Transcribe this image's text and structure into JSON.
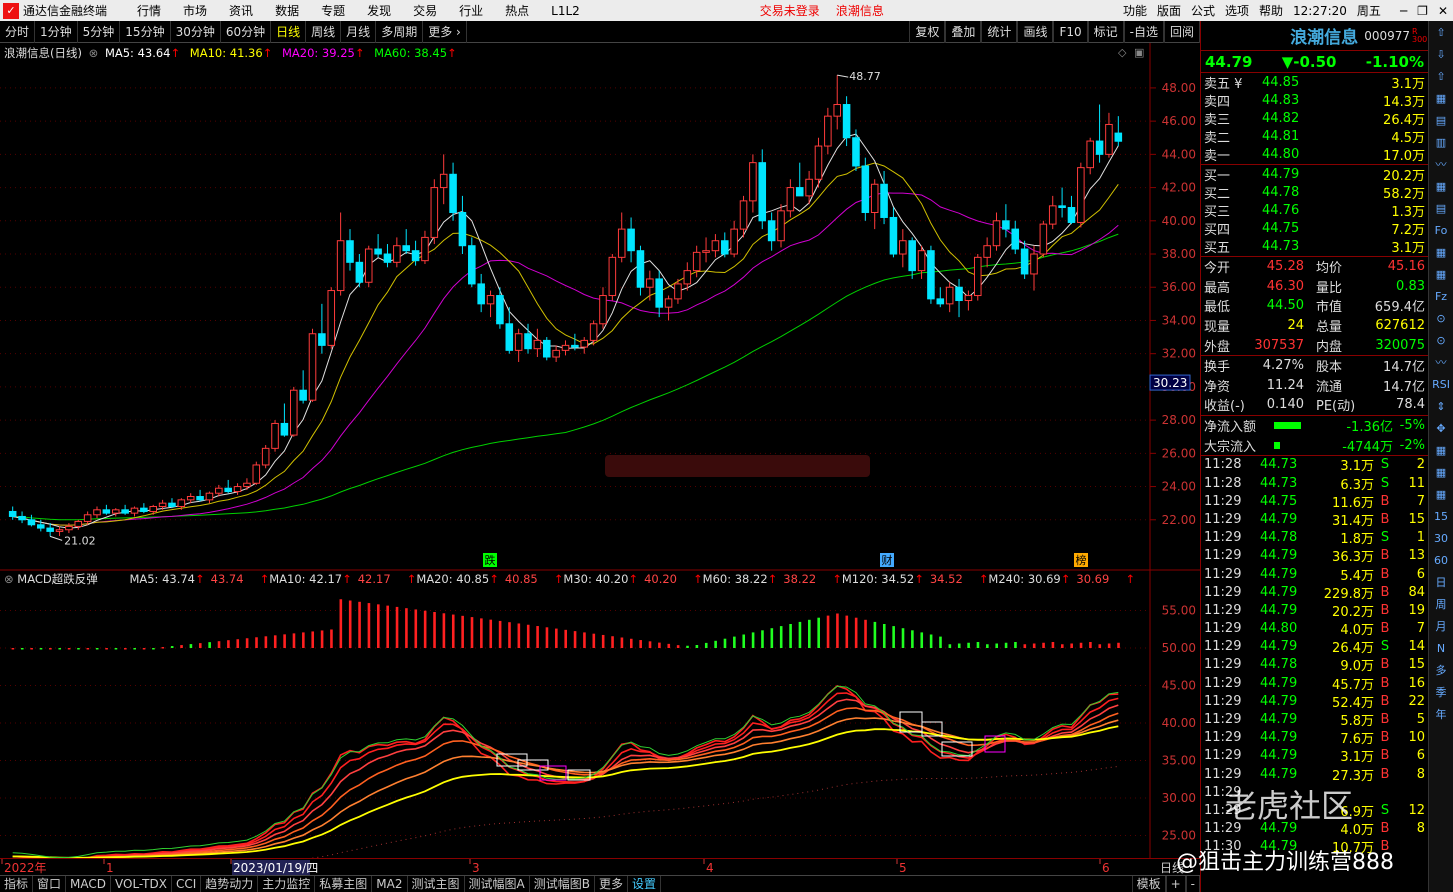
{
  "titlebar": {
    "app": "通达信金融终端",
    "menus": [
      "行情",
      "市场",
      "资讯",
      "数据",
      "专题",
      "发现",
      "交易",
      "行业",
      "热点",
      "L1L2"
    ],
    "status1": "交易未登录",
    "status2": "浪潮信息",
    "right": [
      "功能",
      "版面",
      "公式",
      "选项",
      "帮助",
      "12:27:20",
      "周五"
    ]
  },
  "toolbar": {
    "left": [
      "分时",
      "1分钟",
      "5分钟",
      "15分钟",
      "30分钟",
      "60分钟",
      "日线",
      "周线",
      "月线",
      "多周期",
      "更多"
    ],
    "active": "日线",
    "right": [
      "复权",
      "叠加",
      "统计",
      "画线",
      "F10",
      "标记",
      "-自选",
      "回阅"
    ]
  },
  "main": {
    "title": "浪潮信息(日线)",
    "ma": [
      {
        "label": "MA5: 43.64",
        "color": "#ffffff"
      },
      {
        "label": "MA10: 41.36",
        "color": "#ffff00"
      },
      {
        "label": "MA20: 39.25",
        "color": "#ff00ff"
      },
      {
        "label": "MA60: 38.45",
        "color": "#00ff00"
      }
    ],
    "high_label": "48.77",
    "low_label": "21.02",
    "y_ticks": [
      "48.00",
      "46.00",
      "44.00",
      "42.00",
      "40.00",
      "38.00",
      "36.00",
      "34.00",
      "32.00",
      "30.00",
      "28.00",
      "26.00",
      "24.00",
      "22.00"
    ],
    "cursor_label": "30.23",
    "markers": [
      "跌",
      "财",
      "榜"
    ]
  },
  "indicator": {
    "title": "MACD超跌反弹",
    "ma": [
      {
        "label": "MA5: 43.74",
        "val": "43.74"
      },
      {
        "label": "MA10: 42.17",
        "val": "42.17"
      },
      {
        "label": "MA20: 40.85",
        "val": "40.85"
      },
      {
        "label": "M30: 40.20",
        "val": "40.20"
      },
      {
        "label": "M60: 38.22",
        "val": "38.22"
      },
      {
        "label": "M120: 34.52",
        "val": "34.52"
      },
      {
        "label": "M240: 30.69",
        "val": "30.69"
      }
    ],
    "y_ticks": [
      "55.00",
      "50.00",
      "45.00",
      "40.00",
      "35.00",
      "30.00",
      "25.00"
    ]
  },
  "dates": {
    "labels": [
      "2022年",
      "1",
      "2023/01/19/四",
      "3",
      "4",
      "5",
      "6"
    ],
    "right": "日线"
  },
  "stock": {
    "name": "浪潮信息",
    "code": "000977",
    "badge": "R 300",
    "price": "44.79",
    "change": "▼-0.50",
    "pct": "-1.10%"
  },
  "asks": [
    {
      "l": "卖五 ¥",
      "p": "44.85",
      "v": "3.1万"
    },
    {
      "l": "卖四",
      "p": "44.83",
      "v": "14.3万"
    },
    {
      "l": "卖三",
      "p": "44.82",
      "v": "26.4万"
    },
    {
      "l": "卖二",
      "p": "44.81",
      "v": "4.5万"
    },
    {
      "l": "卖一",
      "p": "44.80",
      "v": "17.0万"
    }
  ],
  "bids": [
    {
      "l": "买一",
      "p": "44.79",
      "v": "20.2万"
    },
    {
      "l": "买二",
      "p": "44.78",
      "v": "58.2万"
    },
    {
      "l": "买三",
      "p": "44.76",
      "v": "1.3万"
    },
    {
      "l": "买四",
      "p": "44.75",
      "v": "7.2万"
    },
    {
      "l": "买五",
      "p": "44.73",
      "v": "3.1万"
    }
  ],
  "quote": [
    {
      "a": "今开",
      "b": "45.28",
      "bc": "#f33",
      "c": "均价",
      "d": "45.16",
      "dc": "#f33"
    },
    {
      "a": "最高",
      "b": "46.30",
      "bc": "#f33",
      "c": "量比",
      "d": "0.83",
      "dc": "#0f0"
    },
    {
      "a": "最低",
      "b": "44.50",
      "bc": "#0f0",
      "c": "市值",
      "d": "659.4亿",
      "dc": "#ddd"
    },
    {
      "a": "现量",
      "b": "24",
      "bc": "#ff0",
      "c": "总量",
      "d": "627612",
      "dc": "#ff0"
    },
    {
      "a": "外盘",
      "b": "307537",
      "bc": "#f33",
      "c": "内盘",
      "d": "320075",
      "dc": "#0f0"
    }
  ],
  "quote2": [
    {
      "a": "换手",
      "b": "4.27%",
      "bc": "#ddd",
      "c": "股本",
      "d": "14.7亿",
      "dc": "#ddd"
    },
    {
      "a": "净资",
      "b": "11.24",
      "bc": "#ddd",
      "c": "流通",
      "d": "14.7亿",
      "dc": "#ddd"
    },
    {
      "a": "收益(-)",
      "b": "0.140",
      "bc": "#ddd",
      "c": "PE(动)",
      "d": "78.4",
      "dc": "#ddd"
    }
  ],
  "flow": [
    {
      "a": "净流入额",
      "v": "-1.36亿",
      "p": "-5%",
      "bar": 0.45
    },
    {
      "a": "大宗流入",
      "v": "-4744万",
      "p": "-2%",
      "bar": 0.1
    }
  ],
  "ticks": [
    {
      "t": "11:28",
      "p": "44.73",
      "v": "3.1万",
      "s": "S",
      "n": "2"
    },
    {
      "t": "11:28",
      "p": "44.73",
      "v": "6.3万",
      "s": "S",
      "n": "11"
    },
    {
      "t": "11:29",
      "p": "44.75",
      "v": "11.6万",
      "s": "B",
      "n": "7"
    },
    {
      "t": "11:29",
      "p": "44.79",
      "v": "31.4万",
      "s": "B",
      "n": "15"
    },
    {
      "t": "11:29",
      "p": "44.78",
      "v": "1.8万",
      "s": "S",
      "n": "1"
    },
    {
      "t": "11:29",
      "p": "44.79",
      "v": "36.3万",
      "s": "B",
      "n": "13"
    },
    {
      "t": "11:29",
      "p": "44.79",
      "v": "5.4万",
      "s": "B",
      "n": "6"
    },
    {
      "t": "11:29",
      "p": "44.79",
      "v": "229.8万",
      "s": "B",
      "n": "84"
    },
    {
      "t": "11:29",
      "p": "44.79",
      "v": "20.2万",
      "s": "B",
      "n": "19"
    },
    {
      "t": "11:29",
      "p": "44.80",
      "v": "4.0万",
      "s": "B",
      "n": "7"
    },
    {
      "t": "11:29",
      "p": "44.79",
      "v": "26.4万",
      "s": "S",
      "n": "14"
    },
    {
      "t": "11:29",
      "p": "44.78",
      "v": "9.0万",
      "s": "B",
      "n": "15"
    },
    {
      "t": "11:29",
      "p": "44.79",
      "v": "45.7万",
      "s": "B",
      "n": "16"
    },
    {
      "t": "11:29",
      "p": "44.79",
      "v": "52.4万",
      "s": "B",
      "n": "22"
    },
    {
      "t": "11:29",
      "p": "44.79",
      "v": "5.8万",
      "s": "B",
      "n": "5"
    },
    {
      "t": "11:29",
      "p": "44.79",
      "v": "7.6万",
      "s": "B",
      "n": "10"
    },
    {
      "t": "11:29",
      "p": "44.79",
      "v": "3.1万",
      "s": "B",
      "n": "6"
    },
    {
      "t": "11:29",
      "p": "44.79",
      "v": "27.3万",
      "s": "B",
      "n": "8"
    },
    {
      "t": "11:29",
      "p": "",
      "v": "",
      "s": "",
      "n": ""
    },
    {
      "t": "11:29",
      "p": "",
      "v": "6.9万",
      "s": "S",
      "n": "12"
    },
    {
      "t": "11:29",
      "p": "44.79",
      "v": "4.0万",
      "s": "B",
      "n": "8"
    },
    {
      "t": "11:30",
      "p": "44.79",
      "v": "10.7万",
      "s": "B",
      "n": ""
    }
  ],
  "sideicons": [
    "⇧",
    "⇩",
    "⇧",
    "▦",
    "▤",
    "▥",
    "〰",
    "▦",
    "▤",
    "Fo",
    "▦",
    "▦",
    "Fz",
    "⊙",
    "⊙",
    "〰",
    "RSI",
    "⇕",
    "✥",
    "▦",
    "▦",
    "▦",
    "15",
    "30",
    "60",
    "日",
    "周",
    "月",
    "N",
    "多",
    "季",
    "年"
  ],
  "bottombar": {
    "items": [
      "指标",
      "窗口",
      "MACD",
      "VOL-TDX",
      "CCI",
      "趋势动力",
      "主力监控",
      "私募主图",
      "MA2",
      "测试主图",
      "测试幅图A",
      "测试幅图B",
      "更多",
      "设置"
    ],
    "active": "设置",
    "right": [
      "模板",
      "+",
      "-"
    ]
  },
  "watermark": {
    "w1": "老虎社区",
    "w2": "@狙击主力训练营888"
  },
  "chart_data": {
    "type": "candlestick",
    "ymin": 20.0,
    "ymax": 49.5,
    "bars": [
      [
        22.5,
        22.8,
        22.0,
        22.2
      ],
      [
        22.2,
        22.5,
        21.8,
        22.0
      ],
      [
        22.0,
        22.3,
        21.6,
        21.7
      ],
      [
        21.7,
        22.0,
        21.3,
        21.5
      ],
      [
        21.5,
        21.8,
        21.0,
        21.3
      ],
      [
        21.3,
        21.6,
        21.02,
        21.4
      ],
      [
        21.4,
        21.8,
        21.2,
        21.6
      ],
      [
        21.6,
        22.0,
        21.4,
        21.9
      ],
      [
        21.9,
        22.5,
        21.7,
        22.3
      ],
      [
        22.3,
        22.8,
        22.1,
        22.6
      ],
      [
        22.6,
        22.9,
        22.3,
        22.4
      ],
      [
        22.4,
        22.7,
        22.2,
        22.6
      ],
      [
        22.6,
        22.9,
        22.3,
        22.4
      ],
      [
        22.4,
        22.8,
        22.2,
        22.7
      ],
      [
        22.7,
        23.0,
        22.4,
        22.5
      ],
      [
        22.5,
        22.9,
        22.3,
        22.8
      ],
      [
        22.8,
        23.2,
        22.6,
        23.0
      ],
      [
        23.0,
        23.3,
        22.7,
        22.8
      ],
      [
        22.8,
        23.3,
        22.6,
        23.2
      ],
      [
        23.2,
        23.6,
        23.0,
        23.4
      ],
      [
        23.4,
        23.8,
        23.1,
        23.2
      ],
      [
        23.2,
        23.7,
        23.0,
        23.6
      ],
      [
        23.6,
        24.1,
        23.4,
        23.9
      ],
      [
        23.9,
        24.4,
        23.6,
        23.7
      ],
      [
        23.7,
        24.2,
        23.5,
        24.0
      ],
      [
        24.0,
        24.5,
        23.8,
        24.2
      ],
      [
        24.2,
        25.5,
        24.1,
        25.3
      ],
      [
        25.3,
        26.5,
        25.1,
        26.3
      ],
      [
        26.3,
        28.0,
        26.1,
        27.8
      ],
      [
        27.8,
        29.0,
        27.0,
        27.1
      ],
      [
        27.1,
        30.0,
        27.0,
        29.8
      ],
      [
        29.8,
        31.0,
        29.0,
        29.2
      ],
      [
        29.2,
        33.5,
        29.1,
        33.2
      ],
      [
        33.2,
        35.0,
        32.0,
        32.5
      ],
      [
        32.5,
        36.0,
        32.3,
        35.8
      ],
      [
        35.8,
        40.5,
        35.5,
        38.8
      ],
      [
        38.8,
        39.5,
        37.0,
        37.5
      ],
      [
        37.5,
        38.0,
        36.0,
        36.3
      ],
      [
        36.3,
        38.5,
        36.0,
        38.3
      ],
      [
        38.3,
        39.2,
        37.8,
        38.0
      ],
      [
        38.0,
        38.6,
        37.2,
        37.5
      ],
      [
        37.5,
        39.0,
        37.2,
        38.5
      ],
      [
        38.5,
        39.5,
        38.0,
        38.2
      ],
      [
        38.2,
        38.8,
        37.3,
        37.6
      ],
      [
        37.6,
        39.4,
        37.4,
        39.0
      ],
      [
        39.0,
        42.5,
        38.6,
        42.0
      ],
      [
        42.0,
        44.0,
        41.0,
        42.8
      ],
      [
        42.8,
        43.5,
        40.0,
        40.5
      ],
      [
        40.5,
        41.5,
        38.0,
        38.5
      ],
      [
        38.5,
        39.0,
        36.0,
        36.2
      ],
      [
        36.2,
        36.8,
        34.5,
        35.0
      ],
      [
        35.0,
        35.8,
        34.2,
        35.5
      ],
      [
        35.5,
        36.0,
        33.5,
        33.8
      ],
      [
        33.8,
        34.8,
        32.0,
        32.2
      ],
      [
        32.2,
        33.5,
        31.5,
        33.2
      ],
      [
        33.2,
        33.8,
        32.0,
        32.3
      ],
      [
        32.3,
        33.5,
        31.8,
        32.8
      ],
      [
        32.8,
        33.0,
        31.6,
        31.8
      ],
      [
        31.8,
        32.5,
        31.5,
        32.2
      ],
      [
        32.2,
        32.8,
        31.9,
        32.5
      ],
      [
        32.5,
        33.2,
        32.2,
        32.4
      ],
      [
        32.4,
        33.0,
        32.0,
        32.8
      ],
      [
        32.8,
        34.0,
        32.5,
        33.8
      ],
      [
        33.8,
        36.0,
        33.5,
        35.5
      ],
      [
        35.5,
        38.0,
        35.2,
        37.8
      ],
      [
        37.8,
        40.5,
        37.5,
        39.5
      ],
      [
        39.5,
        40.2,
        37.5,
        38.2
      ],
      [
        38.2,
        38.5,
        35.5,
        36.0
      ],
      [
        36.0,
        37.0,
        35.2,
        36.5
      ],
      [
        36.5,
        37.0,
        34.2,
        34.8
      ],
      [
        34.8,
        35.5,
        34.0,
        35.3
      ],
      [
        35.3,
        36.5,
        35.0,
        36.2
      ],
      [
        36.2,
        37.5,
        35.8,
        37.0
      ],
      [
        37.0,
        38.5,
        36.6,
        38.1
      ],
      [
        38.1,
        39.0,
        37.5,
        38.2
      ],
      [
        38.2,
        39.2,
        37.8,
        38.8
      ],
      [
        38.8,
        39.3,
        37.8,
        38.0
      ],
      [
        38.0,
        40.0,
        37.8,
        39.5
      ],
      [
        39.5,
        41.5,
        39.0,
        41.2
      ],
      [
        41.2,
        44.0,
        40.5,
        43.5
      ],
      [
        43.5,
        44.3,
        39.5,
        40.0
      ],
      [
        40.0,
        40.5,
        38.2,
        38.8
      ],
      [
        38.8,
        41.0,
        38.4,
        40.6
      ],
      [
        40.6,
        42.5,
        40.2,
        42.0
      ],
      [
        42.0,
        43.5,
        41.5,
        41.5
      ],
      [
        41.5,
        43.0,
        41.0,
        42.5
      ],
      [
        42.5,
        45.0,
        42.0,
        44.5
      ],
      [
        44.5,
        46.8,
        44.0,
        46.3
      ],
      [
        46.3,
        48.77,
        45.5,
        47.0
      ],
      [
        47.0,
        47.5,
        44.5,
        45.0
      ],
      [
        45.0,
        45.5,
        43.0,
        43.3
      ],
      [
        43.3,
        43.8,
        40.0,
        40.5
      ],
      [
        40.5,
        42.5,
        39.5,
        42.2
      ],
      [
        42.2,
        43.0,
        39.8,
        40.2
      ],
      [
        40.2,
        40.8,
        37.8,
        38.0
      ],
      [
        38.0,
        39.5,
        37.2,
        38.8
      ],
      [
        38.8,
        39.0,
        36.5,
        37.0
      ],
      [
        37.0,
        38.5,
        36.5,
        38.2
      ],
      [
        38.2,
        38.5,
        35.0,
        35.3
      ],
      [
        35.3,
        36.0,
        34.8,
        35.0
      ],
      [
        35.0,
        36.3,
        34.5,
        36.0
      ],
      [
        36.0,
        36.5,
        34.2,
        35.2
      ],
      [
        35.2,
        35.8,
        34.6,
        35.5
      ],
      [
        35.5,
        38.0,
        35.2,
        37.8
      ],
      [
        37.8,
        39.0,
        37.2,
        38.5
      ],
      [
        38.5,
        40.5,
        38.2,
        40.0
      ],
      [
        40.0,
        41.0,
        39.0,
        39.5
      ],
      [
        39.5,
        40.0,
        38.0,
        38.3
      ],
      [
        38.3,
        38.8,
        36.5,
        36.8
      ],
      [
        36.8,
        38.5,
        35.8,
        38.0
      ],
      [
        38.0,
        40.0,
        37.8,
        39.8
      ],
      [
        39.8,
        41.5,
        39.5,
        40.9
      ],
      [
        40.9,
        42.0,
        40.2,
        40.8
      ],
      [
        40.8,
        41.5,
        39.8,
        39.9
      ],
      [
        39.9,
        43.5,
        39.6,
        43.2
      ],
      [
        43.2,
        45.0,
        42.8,
        44.8
      ],
      [
        44.8,
        47.0,
        43.5,
        44.0
      ],
      [
        44.0,
        46.5,
        43.8,
        45.8
      ],
      [
        45.28,
        46.3,
        44.5,
        44.79
      ]
    ]
  }
}
